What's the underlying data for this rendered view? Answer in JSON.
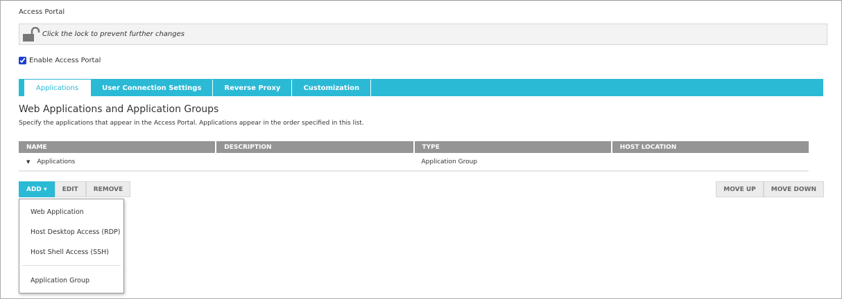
{
  "title": "Access Portal",
  "lock_text": "Click the lock to prevent further changes",
  "enable_label": "Enable Access Portal",
  "enable_checked": true,
  "tabs": [
    "Applications",
    "User Connection Settings",
    "Reverse Proxy",
    "Customization"
  ],
  "section_title": "Web Applications and Application Groups",
  "section_desc": "Specify the applications that appear in the Access Portal. Applications appear in the order specified in this list.",
  "table": {
    "headers": [
      "NAME",
      "DESCRIPTION",
      "TYPE",
      "HOST LOCATION"
    ],
    "rows": [
      {
        "name": "Applications",
        "description": "",
        "type": "Application Group",
        "host": ""
      }
    ]
  },
  "buttons": {
    "add": "ADD",
    "edit": "EDIT",
    "remove": "REMOVE",
    "move_up": "MOVE UP",
    "move_down": "MOVE DOWN"
  },
  "add_menu": [
    "Web Application",
    "Host Desktop Access (RDP)",
    "Host Shell Access (SSH)",
    "Application Group"
  ]
}
